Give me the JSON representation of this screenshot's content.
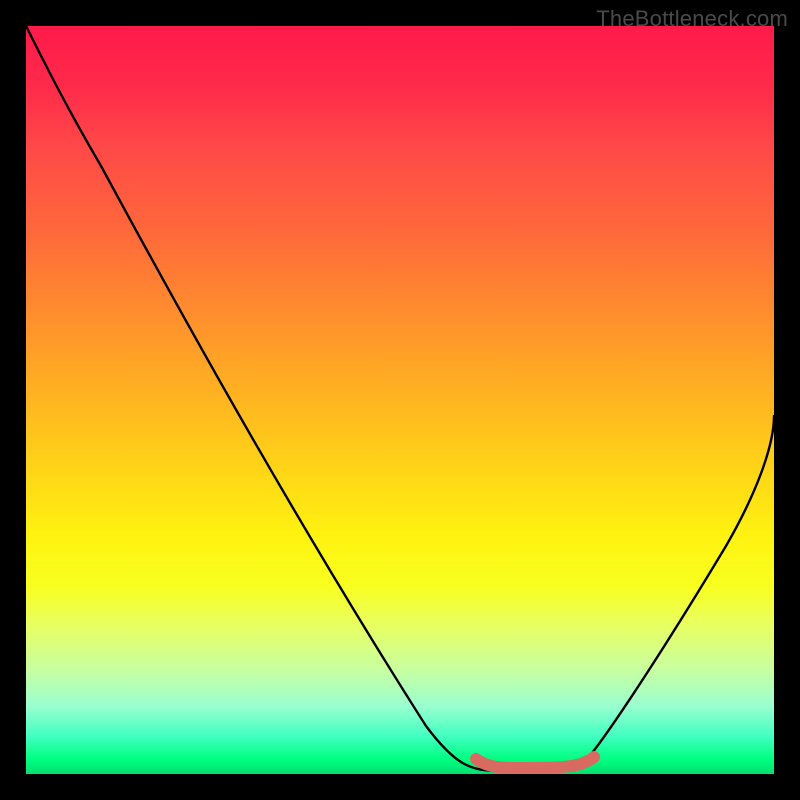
{
  "watermark": "TheBottleneck.com",
  "chart_data": {
    "type": "line",
    "title": "",
    "xlabel": "",
    "ylabel": "",
    "xlim": [
      0,
      100
    ],
    "ylim": [
      0,
      100
    ],
    "series": [
      {
        "name": "bottleneck-curve",
        "x": [
          0,
          5,
          10,
          15,
          20,
          25,
          30,
          35,
          40,
          45,
          50,
          55,
          60,
          62,
          64,
          68,
          72,
          74,
          78,
          82,
          86,
          90,
          94,
          98,
          100
        ],
        "y": [
          100,
          93,
          85,
          77,
          69,
          61,
          53,
          45,
          37,
          29,
          21,
          13,
          5,
          2,
          0.8,
          0.3,
          0.3,
          0.8,
          5,
          12,
          20,
          28,
          36,
          44,
          48
        ]
      },
      {
        "name": "optimal-range-marker",
        "x": [
          61,
          63,
          66,
          70,
          73,
          75
        ],
        "y": [
          1.3,
          0.6,
          0.4,
          0.4,
          0.6,
          1.3
        ]
      }
    ],
    "gradient_stops": [
      {
        "pos": 0,
        "color": "#ff1a4a"
      },
      {
        "pos": 50,
        "color": "#ffd018"
      },
      {
        "pos": 75,
        "color": "#f8ff20"
      },
      {
        "pos": 100,
        "color": "#00e070"
      }
    ]
  }
}
